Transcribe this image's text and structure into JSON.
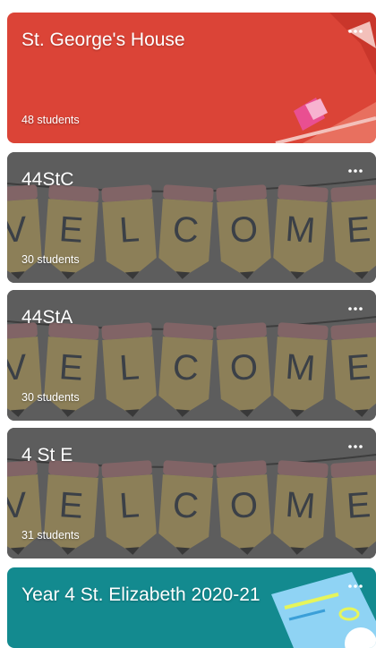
{
  "classes": [
    {
      "title": "St. George's House",
      "students": "48 students",
      "theme": "red",
      "color": "#db4437"
    },
    {
      "title": "44StC",
      "students": "30 students",
      "theme": "welcome",
      "color": "#6b6b6b"
    },
    {
      "title": "44StA",
      "students": "30 students",
      "theme": "welcome",
      "color": "#6b6b6b"
    },
    {
      "title": "4 St E",
      "students": "31 students",
      "theme": "welcome",
      "color": "#6b6b6b"
    },
    {
      "title": "Year 4 St. Elizabeth 2020-21",
      "students": "",
      "theme": "teal",
      "color": "#138a8f"
    }
  ],
  "banner_letters": [
    "V",
    "E",
    "L",
    "C",
    "O",
    "M",
    "E"
  ],
  "icons": {
    "menu": "more-horiz-icon"
  }
}
